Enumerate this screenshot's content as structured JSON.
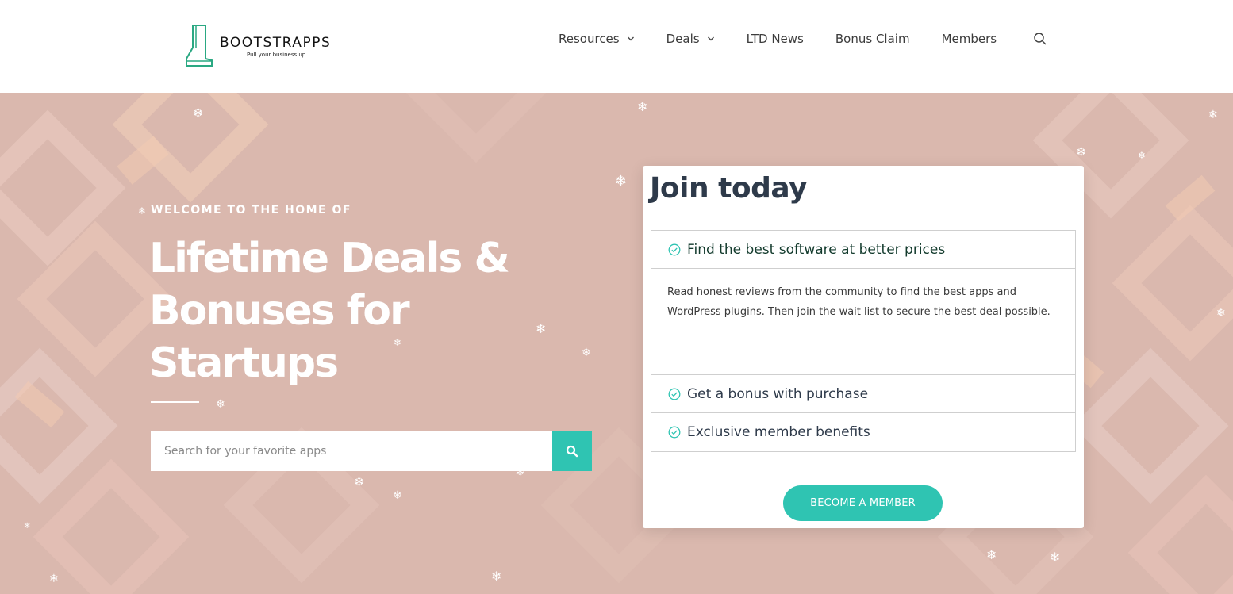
{
  "brand": {
    "name": "BOOTSTRAPPS",
    "tagline": "Pull your business up",
    "accent_color": "#2fc4b2"
  },
  "nav": {
    "items": [
      {
        "label": "Resources",
        "has_dropdown": true
      },
      {
        "label": "Deals",
        "has_dropdown": true
      },
      {
        "label": "LTD News",
        "has_dropdown": false
      },
      {
        "label": "Bonus Claim",
        "has_dropdown": false
      },
      {
        "label": "Members",
        "has_dropdown": false
      }
    ],
    "search_icon": "search-icon"
  },
  "hero": {
    "eyebrow": "WELCOME TO THE HOME OF",
    "headline": "Lifetime Deals & Bonuses for Startups",
    "background_color": "#dab8ae",
    "search": {
      "placeholder": "Search for your favorite apps",
      "button_icon": "search-icon"
    }
  },
  "join_card": {
    "title": "Join today",
    "items": [
      {
        "label": "Find the best software at better prices",
        "expanded": true,
        "body": "Read honest reviews from the community to find the best apps and WordPress plugins. Then join the wait list to secure the best deal possible."
      },
      {
        "label": "Get a bonus with purchase",
        "expanded": false
      },
      {
        "label": "Exclusive member benefits",
        "expanded": false
      }
    ],
    "cta_label": "BECOME A MEMBER"
  }
}
